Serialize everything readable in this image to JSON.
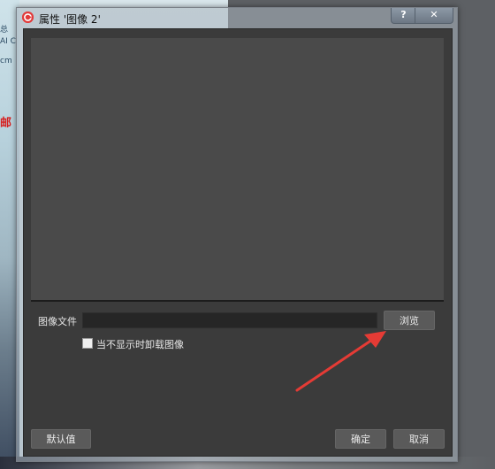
{
  "background": {
    "left_snippets": [
      "总",
      "AI C",
      "cm",
      "邮件"
    ]
  },
  "dialog": {
    "title": "属性 '图像 2'",
    "help_glyph": "?",
    "close_glyph": "✕",
    "app_icon": "app-logo-icon"
  },
  "form": {
    "image_file_label": "图像文件",
    "image_file_value": "",
    "browse_label": "浏览",
    "unload_checkbox_label": "当不显示时卸载图像",
    "unload_checked": false
  },
  "footer": {
    "default_label": "默认值",
    "ok_label": "确定",
    "cancel_label": "取消"
  },
  "colors": {
    "arrow": "#e53b35",
    "dialog_bg": "#3b3b3b",
    "preview_bg": "#4a4a4a"
  }
}
